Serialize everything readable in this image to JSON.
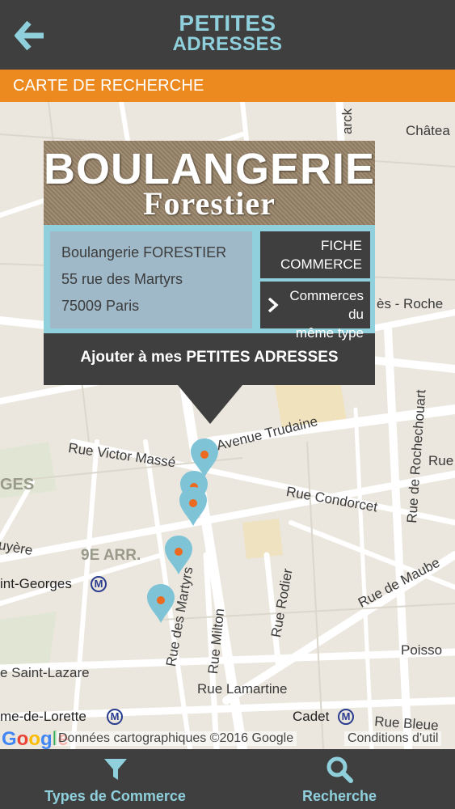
{
  "header": {
    "logo_line1": "PETITES",
    "logo_line2": "ADRESSES",
    "back_icon": "arrow-left-icon"
  },
  "section": {
    "title": "CARTE DE RECHERCHE"
  },
  "popup": {
    "banner_name": "BOULANGERIE",
    "banner_sub": "Forestier",
    "address_lines": [
      "Boulangerie FORESTIER",
      "55 rue des Martyrs",
      "75009 Paris"
    ],
    "btn_fiche": [
      "FICHE",
      "COMMERCE"
    ],
    "btn_same": [
      "Commerces du",
      "même type"
    ],
    "btn_add": "Ajouter à mes PETITES ADRESSES"
  },
  "map": {
    "labels": {
      "chateau": "Châtea",
      "arck": "arck",
      "roche": "ès - Roche",
      "avenue_trudaine": "Avenue Trudaine",
      "victor_masse": "Rue Victor Massé",
      "ges": "GES",
      "condorcet": "Rue Condorcet",
      "rochechouart": "Rue de Rochechouart",
      "rue_right": "Rue",
      "uyere": "uyère",
      "arr": "9E ARR.",
      "st_georges": "int-Georges",
      "maubeuge": "Rue de Maube",
      "rodier": "Rue Rodier",
      "martyrs": "Rue des Martyrs",
      "milton": "Rue Milton",
      "poisso": "Poisso",
      "st_lazare": "e Saint-Lazare",
      "lamartine": "Rue Lamartine",
      "lorette": "me-de-Lorette",
      "cadet": "Cadet",
      "bleue": "Rue Bleue",
      "metro": "M"
    },
    "markers": 5,
    "marker_color": "#7ec4d6",
    "marker_dot_color": "#ec6a1f"
  },
  "attribution": {
    "google": "Google",
    "credits": "Données cartographiques ©2016 Google",
    "terms": "Conditions d'util"
  },
  "tabs": {
    "types_label": "Types de Commerce",
    "types_icon": "filter-icon",
    "search_label": "Recherche",
    "search_icon": "search-icon"
  },
  "colors": {
    "bar": "#3f3f3f",
    "accent": "#8fd0dc",
    "orange": "#ec8a1f"
  }
}
